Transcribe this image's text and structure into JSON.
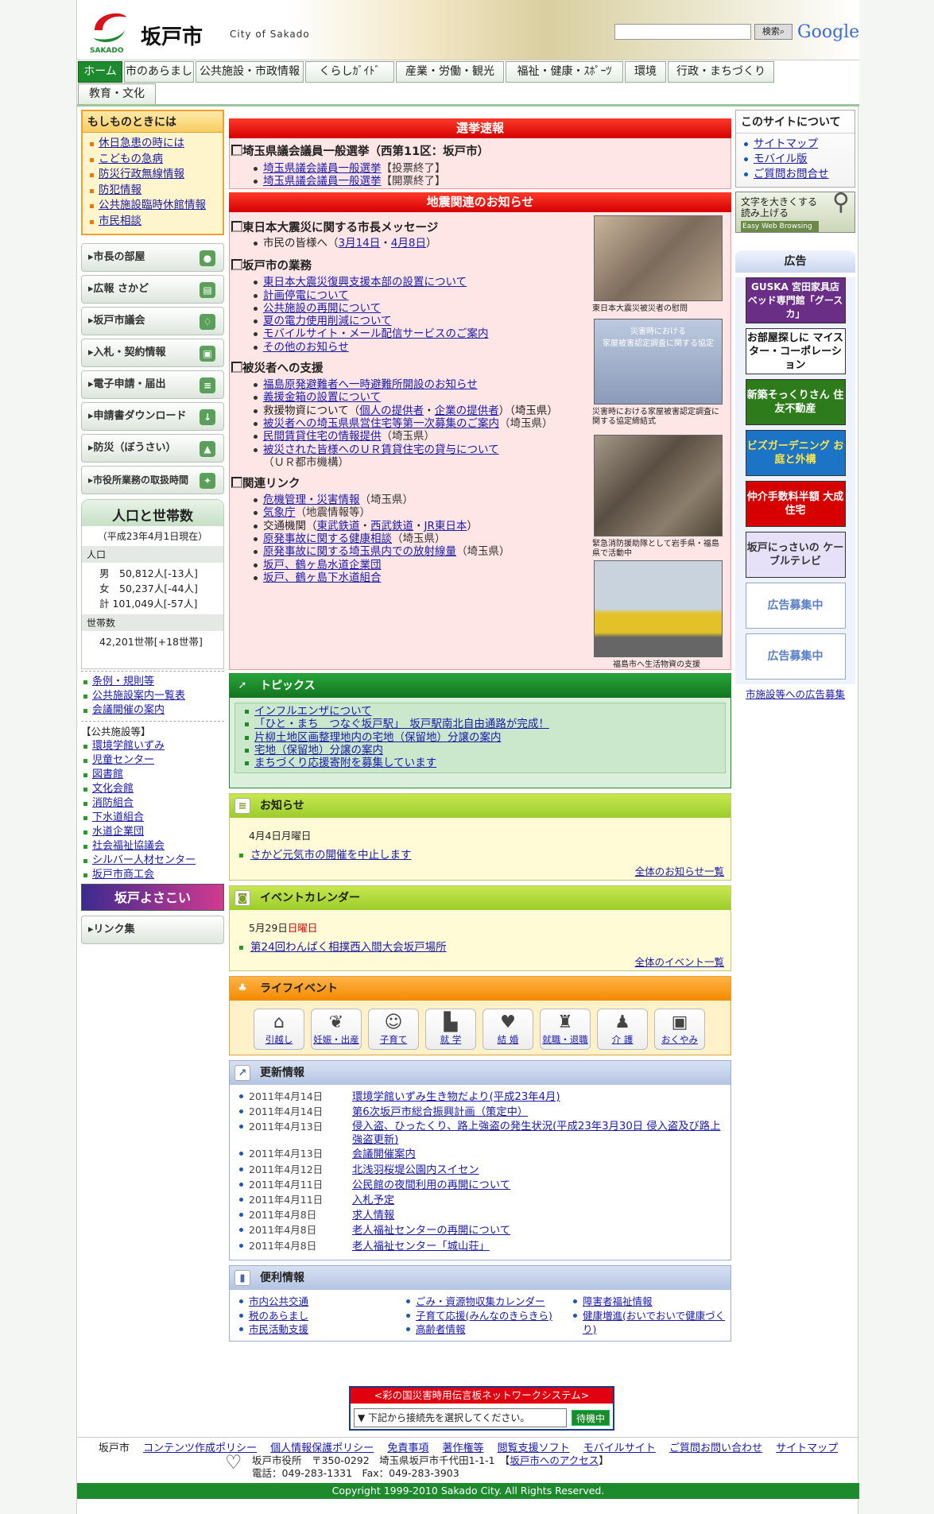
{
  "header": {
    "site_title": "坂戸市",
    "site_subtitle": "City of Sakado",
    "logo_text": "SAKADO",
    "search_button": "検索",
    "google": "Google"
  },
  "nav": [
    "ホーム",
    "市のあらまし",
    "公共施設・市政情報",
    "くらしｶﾞｲﾄﾞ",
    "産業・労働・観光",
    "福祉・健康・ｽﾎﾟｰﾂ",
    "環境",
    "行政・まちづくり",
    "教育・文化"
  ],
  "emergency": {
    "title": "もしものときには",
    "items": [
      "休日急患の時には",
      "こどもの急病",
      "防災行政無線情報",
      "防犯情報",
      "公共施設臨時休館情報",
      "市民相談"
    ]
  },
  "side_buttons": [
    "市長の部屋",
    "広報 さかど",
    "坂戸市議会",
    "入札・契約情報",
    "電子申請・届出",
    "申請書ダウンロード",
    "防災（ぼうさい）",
    "市役所業務の取扱時間"
  ],
  "population": {
    "title": "人口と世帯数",
    "date": "（平成23年4月1日現在）",
    "pop_label": "人口",
    "rows": [
      "男　50,812人[-13人]",
      "女　50,237人[-44人]",
      "計 101,049人[-57人]"
    ],
    "household_label": "世帯数",
    "households": "42,201世帯[+18世帯]"
  },
  "left_links": [
    "条例・規則等",
    "公共施設案内一覧表",
    "会議開催の案内"
  ],
  "facilities_label": "【公共施設等】",
  "facilities": [
    "環境学館いずみ",
    "児童センター",
    "図書館",
    "文化会館",
    "消防組合",
    "下水道組合",
    "水道企業団",
    "社会福祉協議会",
    "シルバー人材センター",
    "坂戸市商工会"
  ],
  "yosakoi": "坂戸よさこい",
  "links_btn": "リンク集",
  "election": {
    "header": "選挙速報",
    "title": "埼玉県議会議員一般選挙（西第11区：坂戸市）",
    "items": [
      {
        "link": "埼玉県議会議員一般選挙",
        "note": "【投票終了】"
      },
      {
        "link": "埼玉県議会議員一般選挙",
        "note": "【開票終了】"
      }
    ]
  },
  "quake": {
    "header": "地震関連のお知らせ",
    "s1_title": "東日本大震災に関する市長メッセージ",
    "s1_prefix": "市民の皆様へ（",
    "s1_l1": "3月14日",
    "s1_sep": "・",
    "s1_l2": "4月8日",
    "s1_suffix": "）",
    "s2_title": "坂戸市の業務",
    "s2_items": [
      "東日本大震災復興支援本部の設置について",
      "計画停電について",
      "公共施設の再開について",
      "夏の電力使用削減について",
      "モバイルサイト・メール配信サービスのご案内",
      "その他のお知らせ"
    ],
    "s3_title": "被災者への支援",
    "s3_i1": "福島原発避難者へ一時避難所開設のお知らせ",
    "s3_i2": "義援金箱の設置について",
    "s3_i3a": "救援物資について（",
    "s3_i3b": "個人の提供者",
    "s3_i3c": "・",
    "s3_i3d": "企業の提供者",
    "s3_i3e": "）（埼玉県）",
    "s3_i4": "被災者への埼玉県県営住宅等第一次募集のご案内",
    "s3_i4n": "（埼玉県）",
    "s3_i5": "民間賃貸住宅の情報提供",
    "s3_i5n": "（埼玉県）",
    "s3_i6": "被災された皆様へのＵＲ賃貸住宅の貸与について",
    "s3_i6n": "（ＵＲ都市機構）",
    "s4_title": "関連リンク",
    "s4_i1": "危機管理・災害情報",
    "s4_i1n": "（埼玉県）",
    "s4_i2": "気象庁",
    "s4_i2n": "（地震情報等）",
    "s4_i3a": "交通機関（",
    "s4_i3b": "東武鉄道",
    "s4_i3c": "・",
    "s4_i3d": "西武鉄道",
    "s4_i3e": "・",
    "s4_i3f": "JR東日本",
    "s4_i3g": "）",
    "s4_i4": "原発事故に関する健康相談",
    "s4_i4n": "（埼玉県）",
    "s4_i5": "原発事故に関する埼玉県内での放射線量",
    "s4_i5n": "（埼玉県）",
    "s4_i6": "坂戸、鶴ヶ島水道企業団",
    "s4_i7": "坂戸、鶴ヶ島下水道組合",
    "captions": [
      "東日本大震災被災者の慰問",
      "災害時における家屋被害認定調査に関する協定締結式",
      "緊急消防援助隊として岩手県・福島県で活動中",
      "福島市へ生活物資の支援"
    ],
    "photo_texts": [
      "災害時における\n家屋被害認定調査に関する協定"
    ]
  },
  "topics": {
    "title": "トピックス",
    "items": [
      "インフルエンザについて",
      "「ひと・まち　つなぐ坂戸駅」　坂戸駅南北自由通路が完成！",
      "片柳土地区画整理地内の宅地（保留地）分譲の案内",
      "宅地（保留地）分譲の案内",
      "まちづくり応援寄附を募集しています"
    ]
  },
  "notice": {
    "title": "お知らせ",
    "date": "4月4日月曜日",
    "item": "さかど元気市の開催を中止します",
    "all": "全体のお知らせ一覧"
  },
  "event": {
    "title": "イベントカレンダー",
    "date_prefix": "5月29日",
    "date_day": "日曜日",
    "item": "第24回わんぱく相撲西入間大会坂戸場所",
    "all": "全体のイベント一覧"
  },
  "life": {
    "title": "ライフイベント",
    "items": [
      "引越し",
      "妊娠・出産",
      "子育て",
      "就 学",
      "結 婚",
      "就職・退職",
      "介 護",
      "おくやみ"
    ]
  },
  "updates": {
    "title": "更新情報",
    "rows": [
      {
        "date": "2011年4月14日",
        "text": "環境学館いずみ生き物だより(平成23年4月)"
      },
      {
        "date": "2011年4月14日",
        "text": "第6次坂戸市総合振興計画（策定中）"
      },
      {
        "date": "2011年4月13日",
        "text": "侵入盗、ひったくり、路上強盗の発生状況(平成23年3月30日 侵入盗及び路上強盗更新)"
      },
      {
        "date": "2011年4月13日",
        "text": "会議開催案内"
      },
      {
        "date": "2011年4月12日",
        "text": "北浅羽桜堤公園内スイセン"
      },
      {
        "date": "2011年4月11日",
        "text": "公民館の夜間利用の再開について"
      },
      {
        "date": "2011年4月11日",
        "text": "入札予定"
      },
      {
        "date": "2011年4月8日",
        "text": "求人情報"
      },
      {
        "date": "2011年4月8日",
        "text": "老人福祉センターの再開について"
      },
      {
        "date": "2011年4月8日",
        "text": "老人福祉センター「城山荘」"
      }
    ]
  },
  "useful": {
    "title": "便利情報",
    "col1": [
      "市内公共交通",
      "税のあらまし",
      "市民活動支援"
    ],
    "col2": [
      "ごみ・資源物収集カレンダー",
      "子育て応援(みんなのきらきら)",
      "高齢者情報"
    ],
    "col3": [
      "障害者福祉情報",
      "健康増進(おいでおいで健康づくり)"
    ]
  },
  "about": {
    "title": "このサイトについて",
    "items": [
      "サイトマップ",
      "モバイル版",
      "ご質問お問合せ"
    ],
    "ewb_line1": "文字を大きくする",
    "ewb_line2": "読み上げる",
    "ewb_sub": "Easy Web Browsing"
  },
  "ads": {
    "title": "広告",
    "items": [
      "GUSKA 宮田家具店 ベッド専門館「グースカ」",
      "お部屋探しに マイスター・コーポレーション",
      "新築そっくりさん 住友不動産",
      "ビズガーデニング お庭と外構",
      "仲介手数料半額 大成住宅",
      "坂戸にっさいの ケーブルテレビ",
      "広告募集中",
      "広告募集中"
    ],
    "footer_link": "市施設等への広告募集"
  },
  "dengon": {
    "title": "<彩の国災害時用伝言板ネットワークシステム>",
    "select": "▼ 下記から接続先を選択してください。",
    "button": "待機中"
  },
  "footer": {
    "city": "坂戸市",
    "links": [
      "コンテンツ作成ポリシー",
      "個人情報保護ポリシー",
      "免責事項",
      "著作権等",
      "閲覧支援ソフト",
      "モバイルサイト",
      "ご質問お問い合わせ",
      "サイトマップ"
    ],
    "office": "坂戸市役所　〒350-0292　埼玉県坂戸市千代田1-1-1　【",
    "access": "坂戸市へのアクセス",
    "office_end": "】",
    "phone": "電話：049-283-1331　Fax：049-283-3903",
    "copyright": "Copyright 1999-2010 Sakado City. All Rights Reserved."
  }
}
